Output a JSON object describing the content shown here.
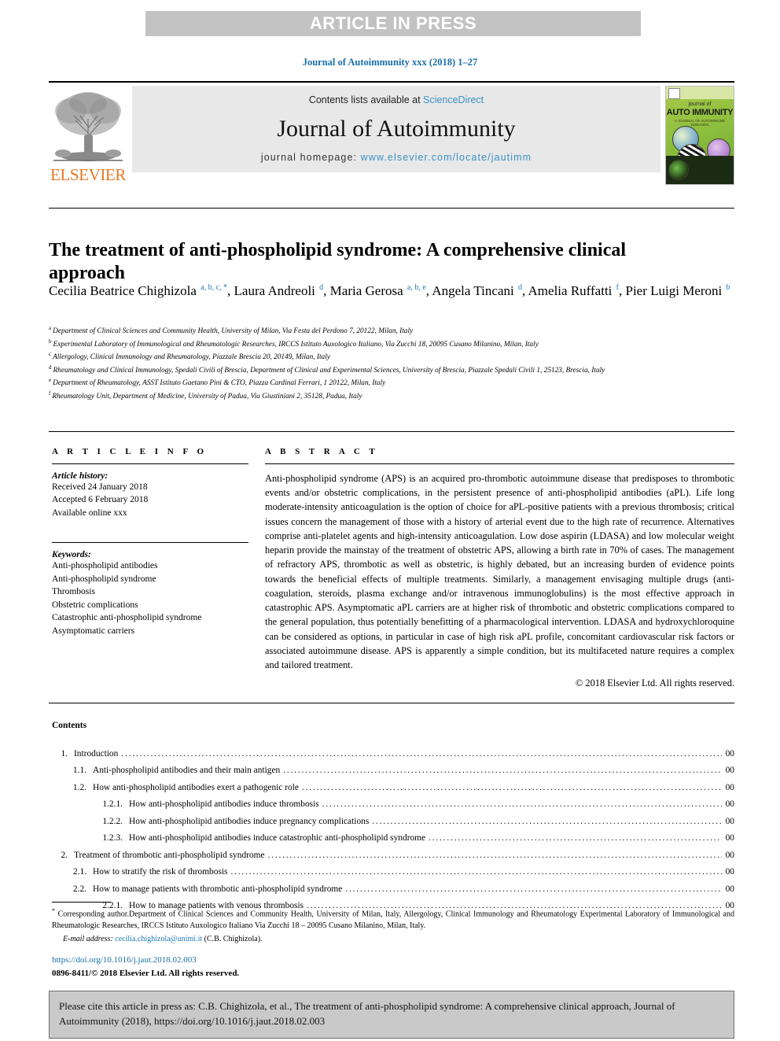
{
  "banner": {
    "text": "ARTICLE IN PRESS"
  },
  "journal_ref": "Journal of Autoimmunity xxx (2018) 1–27",
  "masthead": {
    "contents_prefix": "Contents lists available at ",
    "sciencedirect": "ScienceDirect",
    "journal_name": "Journal of Autoimmunity",
    "homepage_prefix": "journal homepage: ",
    "homepage_url": "www.elsevier.com/locate/jautimm",
    "publisher": "ELSEVIER",
    "cover": {
      "journal_of": "journal of",
      "title": "AUTO IMMUNITY",
      "subtitle": "A JOURNAL OF AUTOIMMUNE DISEASES"
    }
  },
  "article": {
    "title": "The treatment of anti-phospholipid syndrome: A comprehensive clinical approach",
    "authors_html": "Cecilia Beatrice Chighizola <sup>a, b, c, *</sup>, Laura Andreoli <sup>d</sup>, Maria Gerosa <sup>a, b, e</sup>, Angela Tincani <sup>d</sup>, Amelia Ruffatti <sup>f</sup>, Pier Luigi Meroni <sup>b</sup>",
    "affiliations": [
      {
        "mark": "a",
        "text": "Department of Clinical Sciences and Community Health, University of Milan, Via Festa del Perdono 7, 20122, Milan, Italy"
      },
      {
        "mark": "b",
        "text": "Experimental Laboratory of Immunological and Rheumatologic Researches, IRCCS Istituto Auxologico Italiano, Via Zucchi 18, 20095 Cusano Milanino, Milan, Italy"
      },
      {
        "mark": "c",
        "text": "Allergology, Clinical Immunology and Rheumatology, Piazzale Brescia 20, 20149, Milan, Italy"
      },
      {
        "mark": "d",
        "text": "Rheumatology and Clinical Immunology, Spedali Civili of Brescia, Department of Clinical and Experimental Sciences, University of Brescia, Piazzale Spedali Civili 1, 25123, Brescia, Italy"
      },
      {
        "mark": "e",
        "text": "Department of Rheumatology, ASST Istituto Gaetano Pini & CTO, Piazza Cardinal Ferrari, 1 20122, Milan, Italy"
      },
      {
        "mark": "f",
        "text": "Rheumatology Unit, Department of Medicine, University of Padua, Via Giustiniani 2, 35128, Padua, Italy"
      }
    ]
  },
  "article_info": {
    "heading": "A R T I C L E   I N F O",
    "history_label": "Article history:",
    "history": [
      "Received 24 January 2018",
      "Accepted 6 February 2018",
      "Available online xxx"
    ],
    "keywords_label": "Keywords:",
    "keywords": [
      "Anti-phospholipid antibodies",
      "Anti-phospholipid syndrome",
      "Thrombosis",
      "Obstetric complications",
      "Catastrophic anti-phospholipid syndrome",
      "Asymptomatic carriers"
    ]
  },
  "abstract": {
    "heading": "A B S T R A C T",
    "body": "Anti-phospholipid syndrome (APS) is an acquired pro-thrombotic autoimmune disease that predisposes to thrombotic events and/or obstetric complications, in the persistent presence of anti-phospholipid antibodies (aPL). Life long moderate-intensity anticoagulation is the option of choice for aPL-positive patients with a previous thrombosis; critical issues concern the management of those with a history of arterial event due to the high rate of recurrence. Alternatives comprise anti-platelet agents and high-intensity anticoagulation. Low dose aspirin (LDASA) and low molecular weight heparin provide the mainstay of the treatment of obstetric APS, allowing a birth rate in 70% of cases. The management of refractory APS, thrombotic as well as obstetric, is highly debated, but an increasing burden of evidence points towards the beneficial effects of multiple treatments. Similarly, a management envisaging multiple drugs (anti-coagulation, steroids, plasma exchange and/or intravenous immunoglobulins) is the most effective approach in catastrophic APS. Asymptomatic aPL carriers are at higher risk of thrombotic and obstetric complications compared to the general population, thus potentially benefitting of a pharmacological intervention. LDASA and hydroxychloroquine can be considered as options, in particular in case of high risk aPL profile, concomitant cardiovascular risk factors or associated autoimmune disease. APS is apparently a simple condition, but its multifaceted nature requires a complex and tailored treatment.",
    "copyright": "© 2018 Elsevier Ltd. All rights reserved."
  },
  "contents": {
    "title": "Contents",
    "entries": [
      {
        "level": 1,
        "num": "1.",
        "label": "Introduction",
        "page": "00"
      },
      {
        "level": 2,
        "num": "1.1.",
        "label": "Anti-phospholipid antibodies and their main antigen",
        "page": "00"
      },
      {
        "level": 2,
        "num": "1.2.",
        "label": "How anti-phospholipid antibodies exert a pathogenic role",
        "page": "00"
      },
      {
        "level": 3,
        "num": "1.2.1.",
        "label": "How anti-phospholipid antibodies induce thrombosis",
        "page": "00"
      },
      {
        "level": 3,
        "num": "1.2.2.",
        "label": "How anti-phospholipid antibodies induce pregnancy complications",
        "page": "00"
      },
      {
        "level": 3,
        "num": "1.2.3.",
        "label": "How anti-phospholipid antibodies induce catastrophic anti-phospholipid syndrome",
        "page": "00"
      },
      {
        "level": 1,
        "num": "2.",
        "label": "Treatment of thrombotic anti-phospholipid syndrome",
        "page": "00"
      },
      {
        "level": 2,
        "num": "2.1.",
        "label": "How to stratify the risk of thrombosis",
        "page": "00"
      },
      {
        "level": 2,
        "num": "2.2.",
        "label": "How to manage patients with thrombotic anti-phospholipid syndrome",
        "page": "00"
      },
      {
        "level": 3,
        "num": "2.2.1.",
        "label": "How to manage patients with venous thrombosis",
        "page": "00"
      }
    ]
  },
  "footnote": {
    "corresponding": "Corresponding author.Department of Clinical Sciences and Community Health, University of Milan, Italy, Allergology, Clinical Immunology and Rheumatology Experimental Laboratory of Immunological and Rheumatologic Researches, IRCCS Istituto Auxologico Italiano Via Zucchi 18 – 20095 Cusano Milanino, Milan, Italy.",
    "email_label": "E-mail address:",
    "email": "cecilia.chighizola@unimi.it",
    "email_suffix": "(C.B. Chighizola)."
  },
  "doi": {
    "url": "https://doi.org/10.1016/j.jaut.2018.02.003",
    "issn": "0896-8411/© 2018 Elsevier Ltd. All rights reserved."
  },
  "citation_box": {
    "text": "Please cite this article in press as: C.B. Chighizola, et al., The treatment of anti-phospholipid syndrome: A comprehensive clinical approach, Journal of Autoimmunity (2018), https://doi.org/10.1016/j.jaut.2018.02.003"
  },
  "colors": {
    "banner_bg": "#c2c2c2",
    "link_blue": "#1a7ab5",
    "journal_ref_blue": "#1a6fa8",
    "elsevier_orange": "#e87722",
    "masthead_gray": "#e8e8e8",
    "cite_box_gray": "#c9c9c9"
  }
}
